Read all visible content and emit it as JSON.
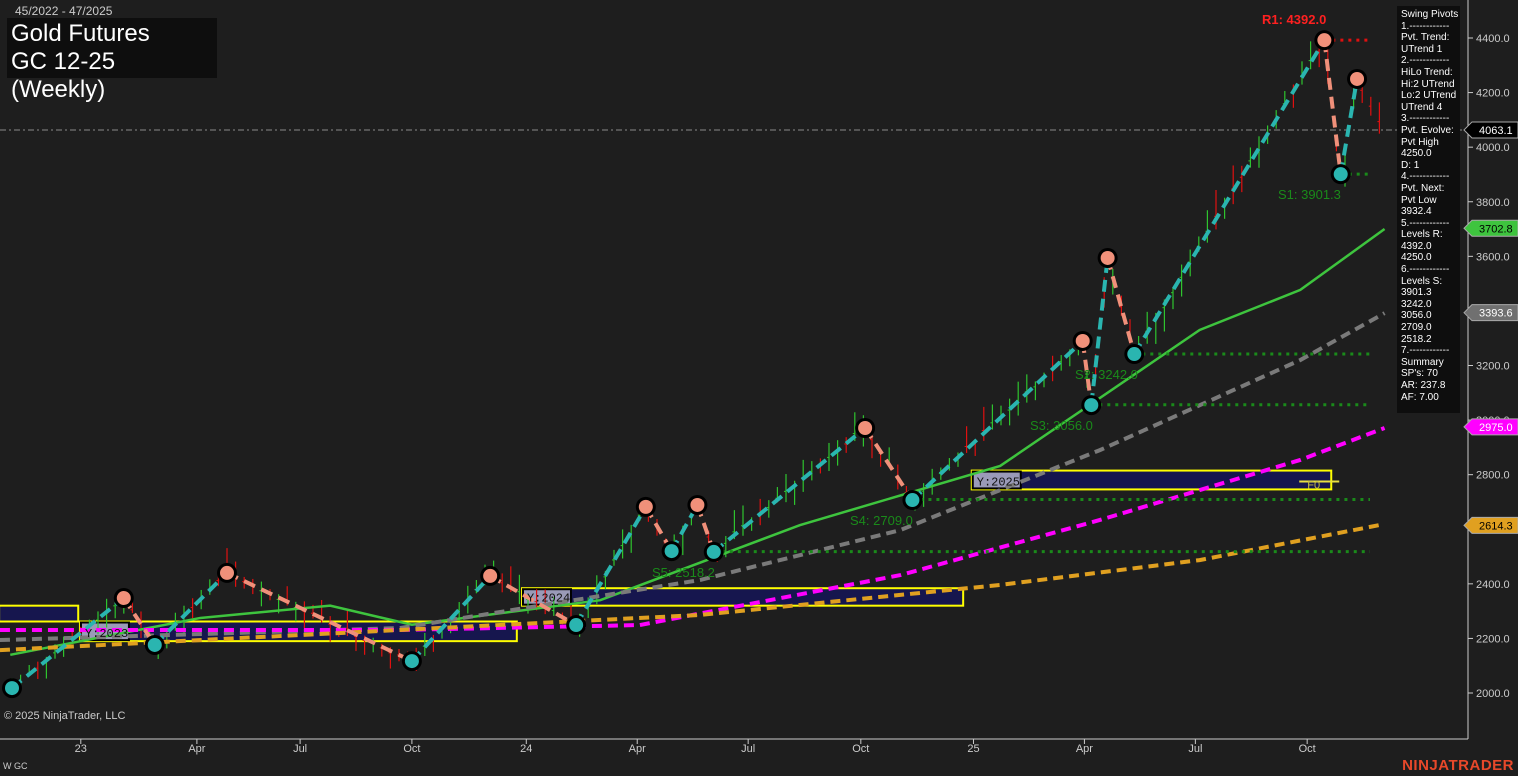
{
  "header": {
    "date_range": "45/2022 - 47/2025",
    "title_line1": "Gold Futures",
    "title_line2": "GC 12-25 (Weekly)"
  },
  "footer": {
    "copyright": "© 2025 NinjaTrader, LLC",
    "symbol": "W GC",
    "brand": "NINJATRADER"
  },
  "info_panel": {
    "lines": [
      "Swing Pivots",
      "1.------------",
      "Pvt. Trend:",
      "UTrend 1",
      "2.------------",
      "HiLo Trend:",
      "Hi:2 UTrend",
      "Lo:2 UTrend",
      "UTrend 4",
      "3.------------",
      "Pvt. Evolve:",
      "Pvt High",
      "4250.0",
      "D: 1",
      "4.------------",
      "Pvt. Next:",
      "Pvt Low",
      "3932.4",
      "5.------------",
      "Levels R:",
      "4392.0",
      "4250.0",
      "6.------------",
      "Levels S:",
      "3901.3",
      "3242.0",
      "3056.0",
      "2709.0",
      "2518.2",
      "7.------------",
      "Summary",
      "SP's: 70",
      "AR: 237.8",
      "AF: 7.00"
    ]
  },
  "colors": {
    "bg": "#1e1e1e",
    "up_leg": "#2ab5b0",
    "down_leg": "#f0907a",
    "ma_fast": "#3ec43e",
    "ma_gray": "#7a7a7a",
    "ma_magenta": "#ff00ff",
    "ma_orange": "#e0a020",
    "support": "#1a8a1a",
    "resistance": "#e01010",
    "year_box": "#ffff00",
    "year_fill": "#16164e"
  },
  "chart_data": {
    "type": "line",
    "title": "Gold Futures GC 12-25 (Weekly)",
    "x_unit": "weeks since 45/2022",
    "ylim": [
      1850,
      4560
    ],
    "yticks": [
      2000,
      2200,
      2400,
      2600,
      2800,
      3000,
      3200,
      3400,
      3600,
      3800,
      4000,
      4200,
      4400
    ],
    "xticks": [
      {
        "label": "23",
        "week": 8
      },
      {
        "label": "Apr",
        "week": 21.5
      },
      {
        "label": "Jul",
        "week": 33.5
      },
      {
        "label": "Oct",
        "week": 46.5
      },
      {
        "label": "24",
        "week": 59.8
      },
      {
        "label": "Apr",
        "week": 72.7
      },
      {
        "label": "Jul",
        "week": 85.6
      },
      {
        "label": "Oct",
        "week": 98.7
      },
      {
        "label": "25",
        "week": 111.8
      },
      {
        "label": "Apr",
        "week": 124.7
      },
      {
        "label": "Jul",
        "week": 137.6
      },
      {
        "label": "Oct",
        "week": 150.6
      }
    ],
    "swing_pivots": [
      {
        "week": 0,
        "price": 2018,
        "type": "low"
      },
      {
        "week": 13,
        "price": 2348,
        "type": "high"
      },
      {
        "week": 16.6,
        "price": 2176,
        "type": "low"
      },
      {
        "week": 25,
        "price": 2440,
        "type": "high"
      },
      {
        "week": 46.5,
        "price": 2117,
        "type": "low"
      },
      {
        "week": 55.6,
        "price": 2429,
        "type": "high"
      },
      {
        "week": 65.6,
        "price": 2249,
        "type": "low"
      },
      {
        "week": 73.7,
        "price": 2682,
        "type": "high"
      },
      {
        "week": 76.7,
        "price": 2520,
        "type": "low"
      },
      {
        "week": 79.7,
        "price": 2689,
        "type": "high"
      },
      {
        "week": 81.6,
        "price": 2517,
        "type": "low"
      },
      {
        "week": 99.2,
        "price": 2971,
        "type": "high"
      },
      {
        "week": 104.7,
        "price": 2707,
        "type": "low"
      },
      {
        "week": 124.5,
        "price": 3290,
        "type": "high"
      },
      {
        "week": 125.5,
        "price": 3055,
        "type": "low"
      },
      {
        "week": 127.4,
        "price": 3594,
        "type": "high"
      },
      {
        "week": 130.5,
        "price": 3242,
        "type": "low"
      },
      {
        "week": 152.6,
        "price": 4392,
        "type": "high"
      },
      {
        "week": 154.5,
        "price": 3901,
        "type": "low"
      },
      {
        "week": 156.4,
        "price": 4250,
        "type": "high"
      },
      {
        "week": 159.4,
        "price": 4063,
        "type": "last"
      }
    ],
    "series": [
      {
        "name": "MA fast",
        "style": "solid",
        "color": "#3ec43e",
        "points": [
          [
            -0.2,
            2140
          ],
          [
            21.9,
            2275
          ],
          [
            37,
            2320
          ],
          [
            46.5,
            2250
          ],
          [
            68.4,
            2340
          ],
          [
            91.6,
            2615
          ],
          [
            114.9,
            2832
          ],
          [
            138.1,
            3330
          ],
          [
            149.8,
            3477
          ],
          [
            159.6,
            3700
          ]
        ]
      },
      {
        "name": "MA gray",
        "style": "dashed",
        "color": "#7a7a7a",
        "points": [
          [
            -1.4,
            2194
          ],
          [
            45.1,
            2238
          ],
          [
            80,
            2414
          ],
          [
            103.3,
            2597
          ],
          [
            126.5,
            2890
          ],
          [
            149.8,
            3220
          ],
          [
            159.6,
            3392
          ]
        ]
      },
      {
        "name": "MA magenta",
        "style": "dashed",
        "color": "#ff00ff",
        "points": [
          [
            -1.4,
            2231
          ],
          [
            45.1,
            2231
          ],
          [
            73,
            2249
          ],
          [
            103.3,
            2432
          ],
          [
            126.5,
            2634
          ],
          [
            149.8,
            2854
          ],
          [
            159.6,
            2971
          ]
        ]
      },
      {
        "name": "MA orange",
        "style": "dashed",
        "color": "#e0a020",
        "points": [
          [
            -1.4,
            2157
          ],
          [
            45.1,
            2231
          ],
          [
            80,
            2286
          ],
          [
            114.9,
            2396
          ],
          [
            138.1,
            2487
          ],
          [
            159.6,
            2619
          ]
        ]
      }
    ],
    "levels": [
      {
        "label": "R1: 4392.0",
        "price": 4392.0,
        "from_week": 152.6,
        "kind": "resistance"
      },
      {
        "label": "S1: 3901.3",
        "price": 3901.3,
        "from_week": 154.5,
        "kind": "support"
      },
      {
        "label": "S2: 3242.0",
        "price": 3242.0,
        "from_week": 130.5,
        "kind": "support"
      },
      {
        "label": "S3: 3056.0",
        "price": 3056.0,
        "from_week": 125.5,
        "kind": "support"
      },
      {
        "label": "S4: 2709.0",
        "price": 2709.0,
        "from_week": 104.7,
        "kind": "support"
      },
      {
        "label": "S5: 2518.2",
        "price": 2518.2,
        "from_week": 81.6,
        "kind": "support"
      }
    ],
    "year_boxes": [
      {
        "label": "",
        "from_week": -1.5,
        "to_week": 7.7,
        "hi": 2320,
        "lo": 2262
      },
      {
        "label": "Y:2023",
        "from_week": 7.9,
        "to_week": 58.7,
        "hi": 2262,
        "lo": 2190
      },
      {
        "label": "Y:2024",
        "from_week": 59.3,
        "to_week": 110.6,
        "hi": 2384,
        "lo": 2320
      },
      {
        "label": "Y:2025",
        "from_week": 111.6,
        "to_week": 153.4,
        "hi": 2815,
        "lo": 2746
      }
    ],
    "f0_label": "F0",
    "last_price": 4063.1,
    "price_tags": [
      {
        "value": "4063.1",
        "bg": "#000000",
        "fg": "#ffffff"
      },
      {
        "value": "3702.8",
        "bg": "#3ec43e",
        "fg": "#000000"
      },
      {
        "value": "3393.6",
        "bg": "#707070",
        "fg": "#ffffff"
      },
      {
        "value": "2975.0",
        "bg": "#ff00ff",
        "fg": "#ffffff"
      },
      {
        "value": "2614.3",
        "bg": "#e0a020",
        "fg": "#000000"
      }
    ]
  }
}
